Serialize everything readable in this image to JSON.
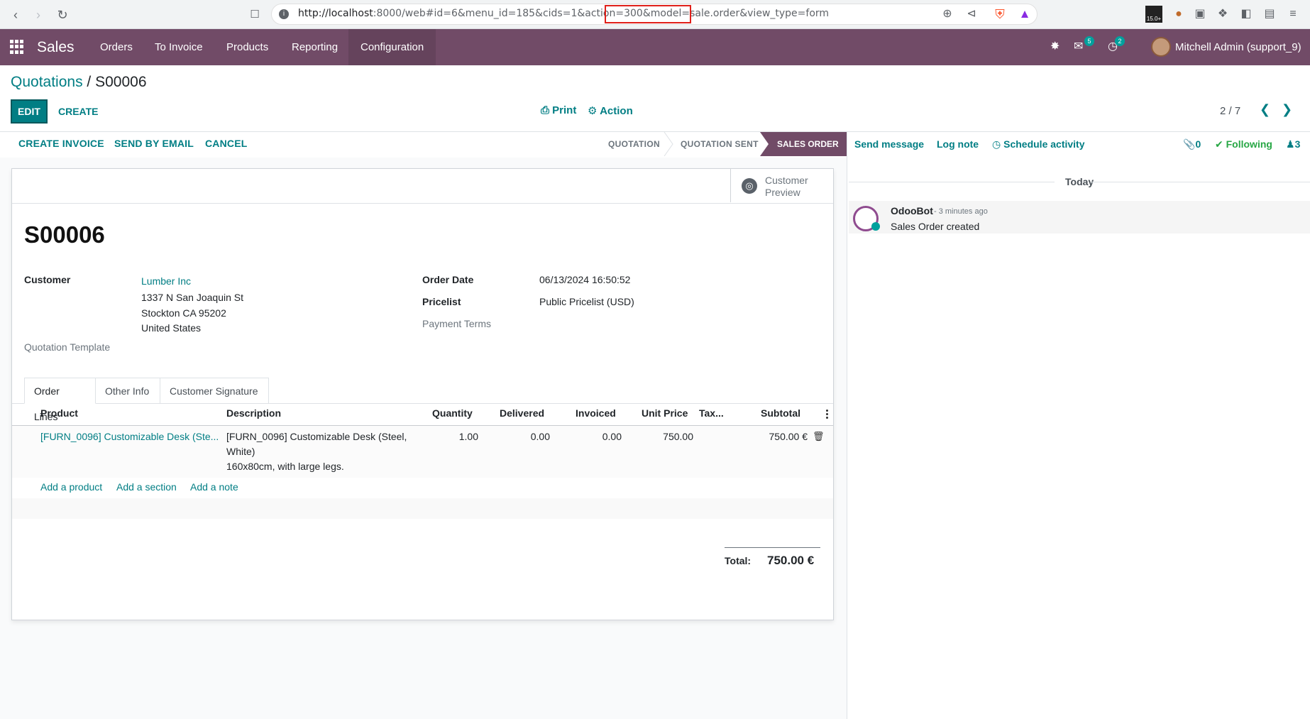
{
  "browser": {
    "url_host": "http://localhost",
    "url_rest": ":8000/web#id=6&menu_id=185&cids=1&action=300",
    "url_highlight": "&model=sale.order",
    "url_tail": "&view_type=form"
  },
  "nav": {
    "brand": "Sales",
    "items": [
      "Orders",
      "To Invoice",
      "Products",
      "Reporting",
      "Configuration"
    ],
    "messages_badge": "5",
    "activities_badge": "2",
    "user": "Mitchell Admin (support_9)"
  },
  "control": {
    "breadcrumb_parent": "Quotations",
    "breadcrumb_sep": " / ",
    "breadcrumb_current": "S00006",
    "edit": "EDIT",
    "create": "CREATE",
    "print": "Print",
    "action": "Action",
    "pager": "2 / 7"
  },
  "statusbar": {
    "buttons": [
      "CREATE INVOICE",
      "SEND BY EMAIL",
      "CANCEL"
    ],
    "stages": [
      "QUOTATION",
      "QUOTATION SENT",
      "SALES ORDER"
    ]
  },
  "form": {
    "preview_line1": "Customer",
    "preview_line2": "Preview",
    "name": "S00006",
    "customer_label": "Customer",
    "customer_name": "Lumber Inc",
    "address1": "1337 N San Joaquin St",
    "address2": "Stockton CA 95202",
    "address3": "United States",
    "template_label": "Quotation Template",
    "order_date_label": "Order Date",
    "order_date": "06/13/2024 16:50:52",
    "pricelist_label": "Pricelist",
    "pricelist": "Public Pricelist (USD)",
    "payment_terms_label": "Payment Terms"
  },
  "tabs": [
    "Order Lines",
    "Other Info",
    "Customer Signature"
  ],
  "table": {
    "headers": [
      "Product",
      "Description",
      "Quantity",
      "Delivered",
      "Invoiced",
      "Unit Price",
      "Tax...",
      "Subtotal"
    ],
    "row": {
      "product": "[FURN_0096] Customizable Desk (Ste...",
      "desc1": "[FURN_0096] Customizable Desk (Steel,",
      "desc2": "White)",
      "desc3": "160x80cm, with large legs.",
      "quantity": "1.00",
      "delivered": "0.00",
      "invoiced": "0.00",
      "unit_price": "750.00",
      "subtotal": "750.00 €"
    },
    "add_product": "Add a product",
    "add_section": "Add a section",
    "add_note": "Add a note",
    "total_label": "Total:",
    "total_value": "750.00 €"
  },
  "chatter": {
    "send_message": "Send message",
    "log_note": "Log note",
    "schedule": "Schedule activity",
    "attachments": "0",
    "following": "Following",
    "followers": "3",
    "today": "Today",
    "author": "OdooBot",
    "time": "- 3 minutes ago",
    "body": "Sales Order created"
  }
}
